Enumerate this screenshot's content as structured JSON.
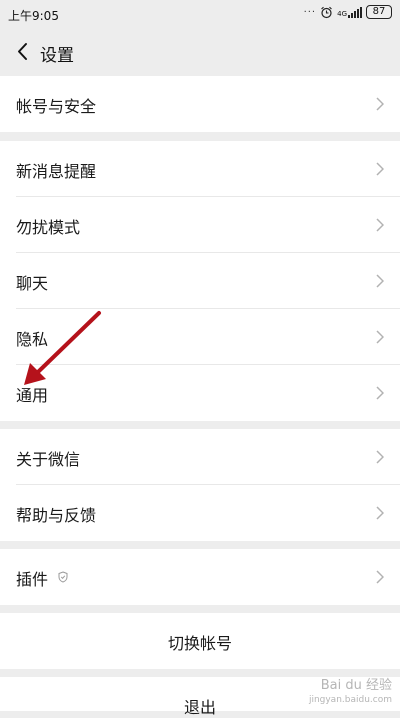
{
  "status_bar": {
    "time": "上午9:05",
    "dots": "···",
    "network": "4G",
    "battery": "87"
  },
  "nav": {
    "title": "设置"
  },
  "menu": {
    "account_security": "帐号与安全",
    "new_message_alert": "新消息提醒",
    "do_not_disturb": "勿扰模式",
    "chat": "聊天",
    "privacy": "隐私",
    "general": "通用",
    "about_wechat": "关于微信",
    "help_feedback": "帮助与反馈",
    "plugins": "插件",
    "switch_account": "切换帐号",
    "logout": "退出"
  },
  "watermark": {
    "brand": "Bai du 经验",
    "url": "jingyan.baidu.com"
  },
  "colors": {
    "page_bg": "#ededed",
    "row_bg": "#ffffff",
    "annotation_arrow": "#b5121b"
  }
}
